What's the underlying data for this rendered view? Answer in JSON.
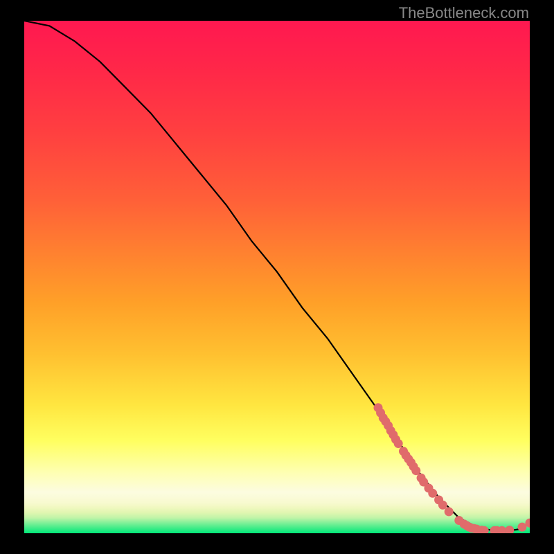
{
  "watermark": "TheBottleneck.com",
  "chart_data": {
    "type": "line",
    "title": "",
    "xlabel": "",
    "ylabel": "",
    "xlim": [
      0,
      100
    ],
    "ylim": [
      0,
      100
    ],
    "curve": {
      "x": [
        0,
        5,
        10,
        15,
        20,
        25,
        30,
        35,
        40,
        45,
        50,
        55,
        60,
        65,
        70,
        74,
        78,
        82,
        86,
        90,
        93,
        96,
        98,
        100
      ],
      "y": [
        100,
        99,
        96,
        92,
        87,
        82,
        76,
        70,
        64,
        57,
        51,
        44,
        38,
        31,
        24,
        18,
        12,
        7,
        3,
        1,
        0.5,
        0.5,
        0.8,
        2
      ]
    },
    "series": [
      {
        "name": "dots",
        "color": "#e06b6b",
        "points": [
          {
            "x": 70.0,
            "y": 24.5
          },
          {
            "x": 70.5,
            "y": 23.5
          },
          {
            "x": 71.0,
            "y": 22.5
          },
          {
            "x": 71.5,
            "y": 21.8
          },
          {
            "x": 72.0,
            "y": 21.0
          },
          {
            "x": 72.5,
            "y": 20.0
          },
          {
            "x": 73.0,
            "y": 19.2
          },
          {
            "x": 73.5,
            "y": 18.3
          },
          {
            "x": 74.0,
            "y": 17.5
          },
          {
            "x": 75.0,
            "y": 16.0
          },
          {
            "x": 75.5,
            "y": 15.2
          },
          {
            "x": 76.0,
            "y": 14.5
          },
          {
            "x": 76.5,
            "y": 13.8
          },
          {
            "x": 77.0,
            "y": 13.0
          },
          {
            "x": 77.5,
            "y": 12.2
          },
          {
            "x": 78.5,
            "y": 10.8
          },
          {
            "x": 79.0,
            "y": 10.0
          },
          {
            "x": 80.0,
            "y": 8.8
          },
          {
            "x": 80.8,
            "y": 7.8
          },
          {
            "x": 82.0,
            "y": 6.5
          },
          {
            "x": 82.8,
            "y": 5.5
          },
          {
            "x": 84.0,
            "y": 4.2
          },
          {
            "x": 86.0,
            "y": 2.5
          },
          {
            "x": 87.0,
            "y": 1.8
          },
          {
            "x": 87.5,
            "y": 1.5
          },
          {
            "x": 88.0,
            "y": 1.2
          },
          {
            "x": 88.5,
            "y": 1.0
          },
          {
            "x": 89.0,
            "y": 0.9
          },
          {
            "x": 89.5,
            "y": 0.8
          },
          {
            "x": 90.5,
            "y": 0.6
          },
          {
            "x": 91.0,
            "y": 0.5
          },
          {
            "x": 93.0,
            "y": 0.5
          },
          {
            "x": 93.5,
            "y": 0.5
          },
          {
            "x": 94.5,
            "y": 0.5
          },
          {
            "x": 96.0,
            "y": 0.6
          },
          {
            "x": 98.5,
            "y": 1.2
          },
          {
            "x": 100.0,
            "y": 2.0
          }
        ]
      }
    ]
  }
}
